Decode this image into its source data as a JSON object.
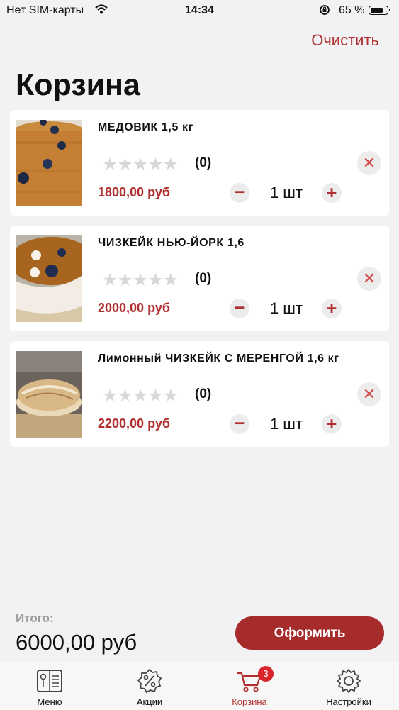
{
  "status_bar": {
    "carrier": "Нет SIM-карты",
    "time": "14:34",
    "battery": "65 %"
  },
  "header": {
    "clear_label": "Очистить",
    "title": "Корзина"
  },
  "cart": {
    "items": [
      {
        "name": "МЕДОВИК 1,5  кг",
        "stars": "★★★★★",
        "rating": 0,
        "rating_count": "(0)",
        "price": "1800,00 руб",
        "qty": "1 шт",
        "minus": "−",
        "plus": "+",
        "remove": "✕"
      },
      {
        "name": "ЧИЗКЕЙК НЬЮ-ЙОРК 1,6",
        "stars": "★★★★★",
        "rating": 0,
        "rating_count": "(0)",
        "price": "2000,00 руб",
        "qty": "1 шт",
        "minus": "−",
        "plus": "+",
        "remove": "✕"
      },
      {
        "name": "Лимонный ЧИЗКЕЙК С МЕРЕНГОЙ 1,6 кг",
        "stars": "★★★★★",
        "rating": 0,
        "rating_count": "(0)",
        "price": "2200,00 руб",
        "qty": "1 шт",
        "minus": "−",
        "plus": "+",
        "remove": "✕"
      }
    ]
  },
  "summary": {
    "total_label": "Итого:",
    "total_value": "6000,00 руб",
    "checkout_label": "Оформить"
  },
  "tabbar": {
    "tabs": [
      {
        "label": "Меню",
        "icon": "menu-book-icon"
      },
      {
        "label": "Акции",
        "icon": "percent-badge-icon"
      },
      {
        "label": "Корзина",
        "icon": "cart-icon",
        "badge": "3"
      },
      {
        "label": "Настройки",
        "icon": "gear-icon"
      }
    ]
  },
  "colors": {
    "accent": "#b0302f",
    "button": "#a62c2b",
    "background": "#f2f2f4",
    "badge": "#d8262c"
  }
}
